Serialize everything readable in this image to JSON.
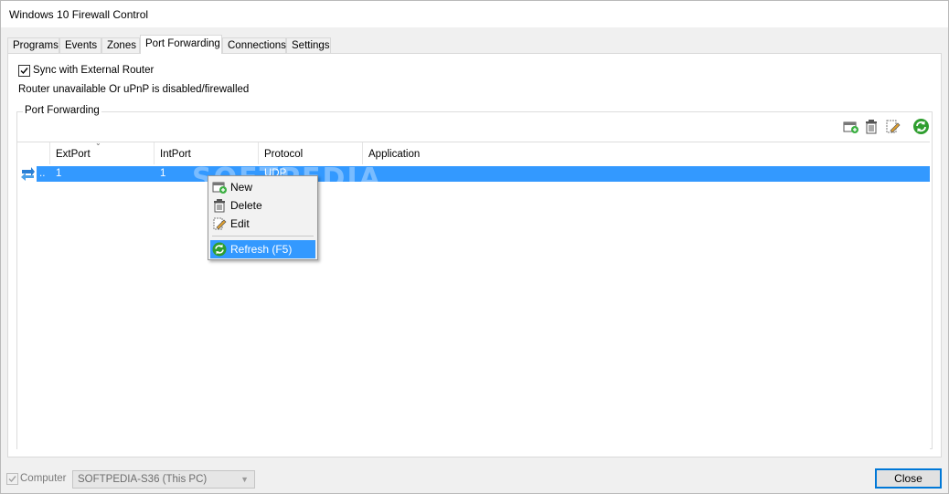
{
  "window": {
    "title": "Windows 10 Firewall Control"
  },
  "tabs": [
    {
      "label": "Programs"
    },
    {
      "label": "Events"
    },
    {
      "label": "Zones"
    },
    {
      "label": "Port Forwarding"
    },
    {
      "label": "Connections"
    },
    {
      "label": "Settings"
    }
  ],
  "port_forwarding": {
    "sync_label": "Sync with External Router",
    "sync_checked": true,
    "status_text": "Router unavailable Or uPnP is disabled/firewalled",
    "group_title": "Port Forwarding",
    "toolbar_icons": [
      "add-rule-icon",
      "delete-icon",
      "edit-icon",
      "refresh-icon"
    ],
    "columns": [
      "ExtPort",
      "IntPort",
      "Protocol",
      "Application"
    ],
    "rows": [
      {
        "first": "..",
        "extport": "1",
        "intport": "1",
        "protocol": "UDP",
        "application": ""
      }
    ]
  },
  "context_menu": {
    "items": [
      {
        "label": "New",
        "icon": "add-rule-icon"
      },
      {
        "label": "Delete",
        "icon": "delete-icon"
      },
      {
        "label": "Edit",
        "icon": "edit-icon"
      },
      {
        "label": "Refresh (F5)",
        "icon": "refresh-icon",
        "highlighted": true
      }
    ]
  },
  "footer": {
    "computer_label": "Computer",
    "computer_checked": true,
    "computer_value": "SOFTPEDIA-S36 (This PC)",
    "close_label": "Close"
  },
  "watermark": "SOFTPEDIA",
  "colors": {
    "selection": "#3399ff",
    "refresh_green": "#2f9e2f",
    "close_border": "#0078d7"
  }
}
